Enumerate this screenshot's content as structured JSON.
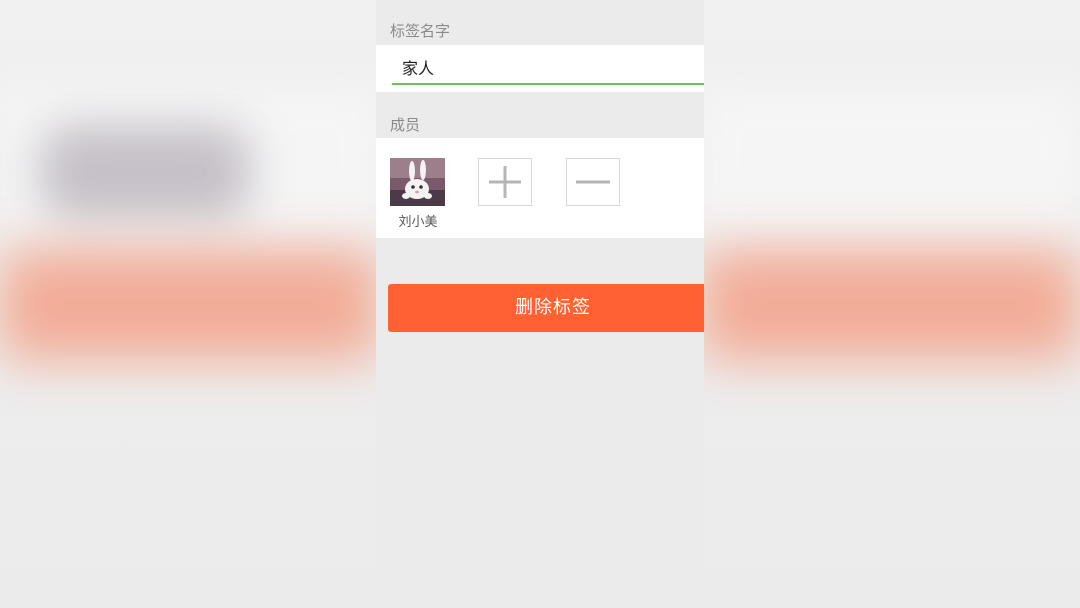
{
  "tag_name_section": {
    "label": "标签名字",
    "value": "家人"
  },
  "members_section": {
    "label": "成员",
    "members": [
      {
        "name": "刘小美",
        "avatar_icon": "white-rabbit-avatar"
      }
    ],
    "add_icon": "plus-icon",
    "remove_icon": "minus-icon"
  },
  "delete_button": {
    "label": "删除标签",
    "color": "#ff6133"
  },
  "colors": {
    "accent_underline": "#6cc05a",
    "background": "#ebebeb",
    "section_label": "#8a8a8a"
  }
}
